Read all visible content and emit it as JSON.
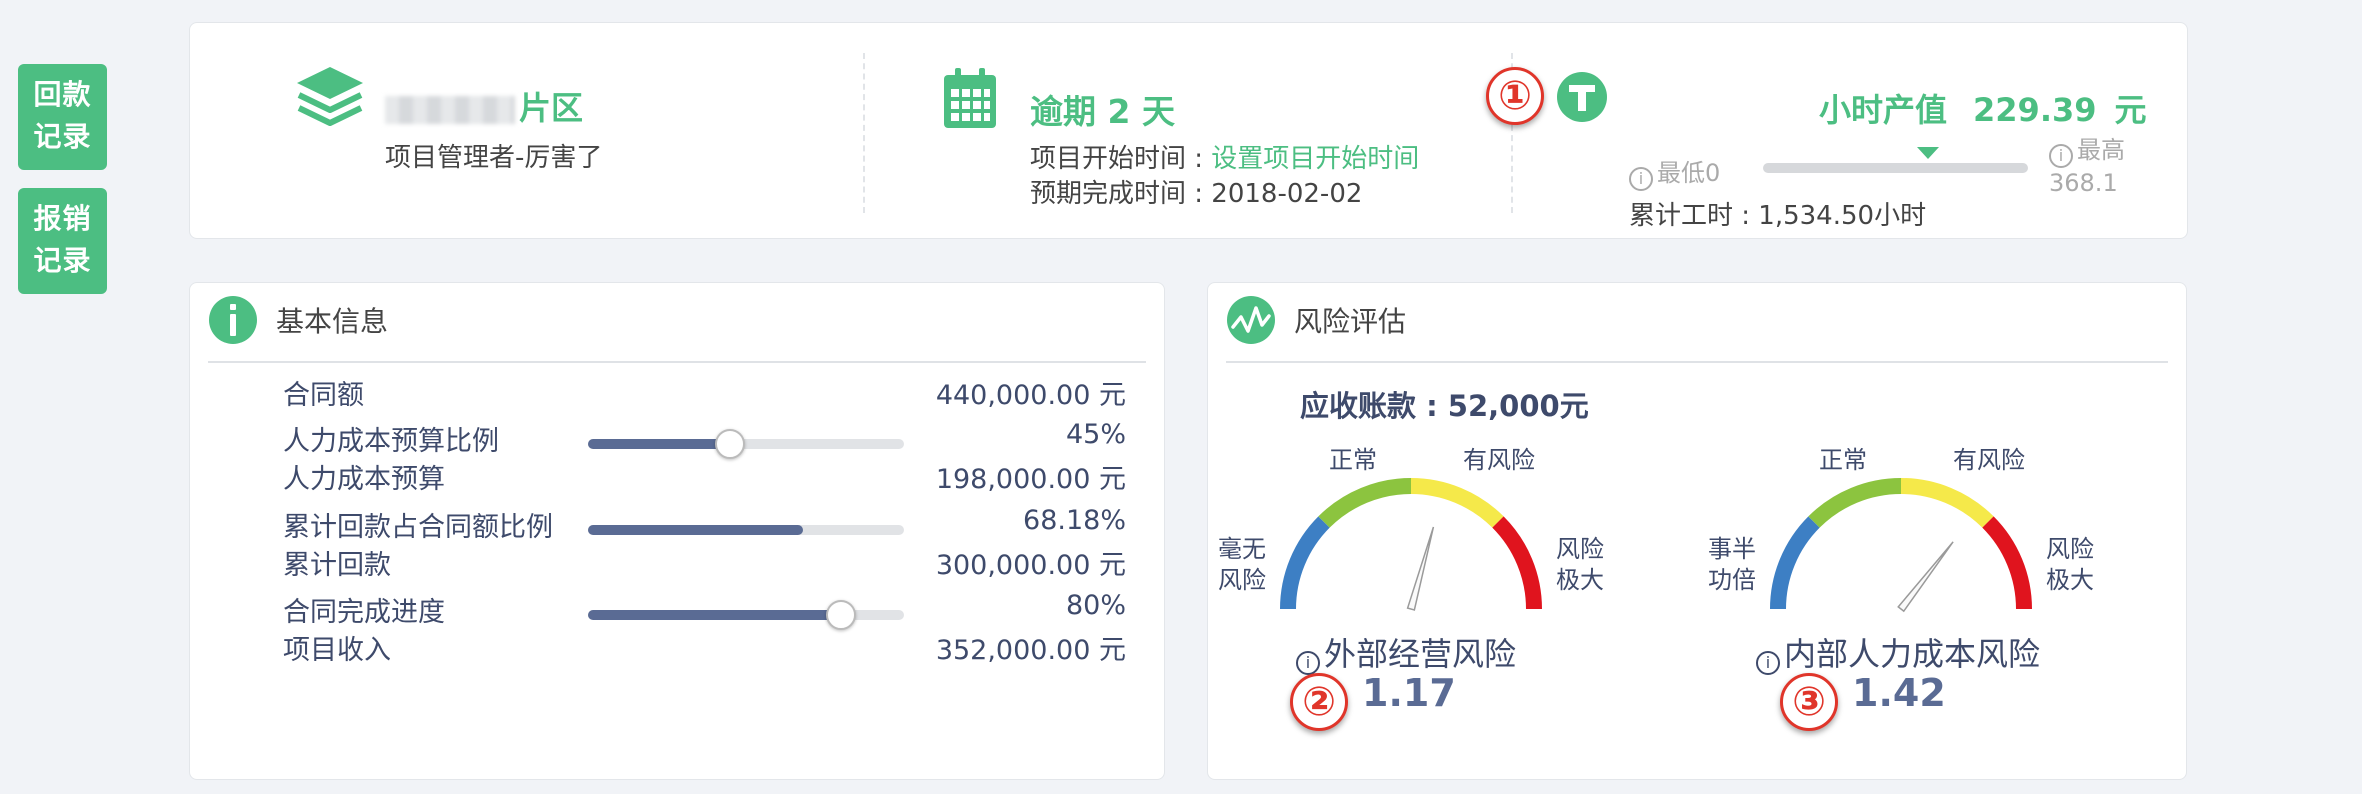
{
  "side_buttons": [
    {
      "line1": "回款",
      "line2": "记录"
    },
    {
      "line1": "报销",
      "line2": "记录"
    }
  ],
  "project": {
    "name_suffix": "片区",
    "manager_text": "项目管理者-厉害了"
  },
  "schedule": {
    "overdue_text": "逾期 2 天",
    "start_label": "项目开始时间 : ",
    "start_link": "设置项目开始时间",
    "end_label": "预期完成时间 : ",
    "end_value": "2018-02-02"
  },
  "hourly": {
    "label": "小时产值",
    "value": "229.39",
    "unit": "元",
    "min_label": "最低0",
    "max_label": "最高",
    "max_value": "368.1",
    "level_fraction": 0.623,
    "cum_hours_text": "累计工时 : 1,534.50小时"
  },
  "callouts": [
    "①",
    "②",
    "③"
  ],
  "basic_info": {
    "title": "基本信息",
    "rows": [
      {
        "label": "合同额",
        "value": "440,000.00 元"
      },
      {
        "label": "人力成本预算比例",
        "value": "45%",
        "slider": 0.45,
        "knob": true
      },
      {
        "label": "人力成本预算",
        "value": "198,000.00 元"
      },
      {
        "label": "累计回款占合同额比例",
        "value": "68.18%",
        "slider": 0.6818,
        "knob": false
      },
      {
        "label": "累计回款",
        "value": "300,000.00 元"
      },
      {
        "label": "合同完成进度",
        "value": "80%",
        "slider": 0.8,
        "knob": true
      },
      {
        "label": "项目收入",
        "value": "352,000.00 元"
      }
    ]
  },
  "risk": {
    "title": "风险评估",
    "receivable_text": "应收账款 : 52,000元",
    "gauges": [
      {
        "name": "外部经营风险",
        "value": "1.17",
        "left_label": [
          "毫无",
          "风险"
        ],
        "normal_label": "正常",
        "risk_label": "有风险",
        "right_label": [
          "风险",
          "极大"
        ],
        "needle_value": 1.17
      },
      {
        "name": "内部人力成本风险",
        "value": "1.42",
        "left_label": [
          "事半",
          "功倍"
        ],
        "normal_label": "正常",
        "risk_label": "有风险",
        "right_label": [
          "风险",
          "极大"
        ],
        "needle_value": 1.42
      }
    ]
  },
  "colors": {
    "accent": "#4cbe82",
    "gauge_blue": "#3d7fc4",
    "gauge_green": "#8cc43f",
    "gauge_yellow": "#f5e94a",
    "gauge_red": "#e0141e"
  }
}
